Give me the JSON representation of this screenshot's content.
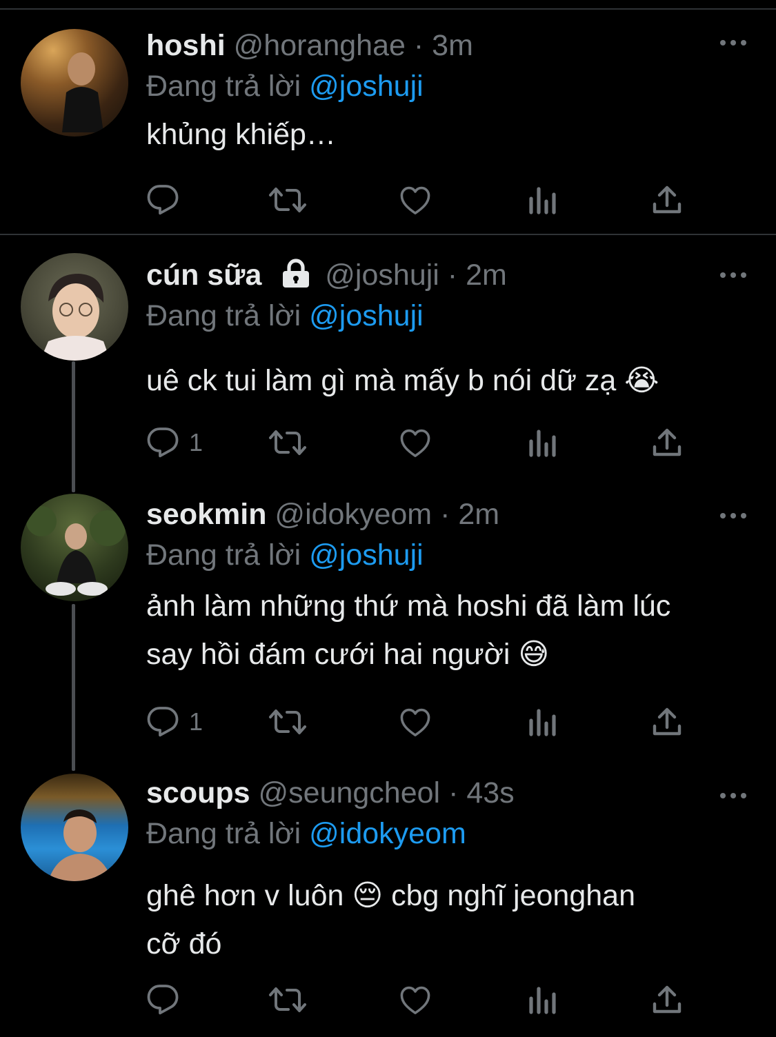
{
  "tweets": [
    {
      "name": "hoshi",
      "handle": "@horanghae",
      "time": "3m",
      "reply_prefix": "Đang trả lời",
      "reply_to": "@joshuji",
      "text_lines": [
        "khủng khiếp…"
      ],
      "reply_count": "",
      "locked": false
    },
    {
      "name": "cún sữa",
      "handle": "@joshuji",
      "time": "2m",
      "reply_prefix": "Đang trả lời",
      "reply_to": "@joshuji",
      "text_lines": [
        "uê ck tui làm gì mà mấy b nói dữ zạ 😭"
      ],
      "reply_count": "1",
      "locked": true
    },
    {
      "name": "seokmin",
      "handle": "@idokyeom",
      "time": "2m",
      "reply_prefix": "Đang trả lời",
      "reply_to": "@joshuji",
      "text_lines": [
        "ảnh làm những thứ mà hoshi đã làm lúc",
        "say hồi đám cưới hai người 😅"
      ],
      "reply_count": "1",
      "locked": false
    },
    {
      "name": "scoups",
      "handle": "@seungcheol",
      "time": "43s",
      "reply_prefix": "Đang trả lời",
      "reply_to": "@idokyeom",
      "text_lines": [
        "ghê hơn v luôn 😔  cbg nghĩ jeonghan",
        "cỡ đó"
      ],
      "reply_count": "",
      "locked": false
    }
  ],
  "separator": "·",
  "icons": [
    "reply-icon",
    "retweet-icon",
    "like-icon",
    "views-icon",
    "share-icon",
    "more-icon",
    "lock-icon"
  ],
  "colors": {
    "background": "#000000",
    "text": "#e7e9ea",
    "muted": "#71767b",
    "link": "#1d9bf0",
    "divider": "#2f3336"
  }
}
